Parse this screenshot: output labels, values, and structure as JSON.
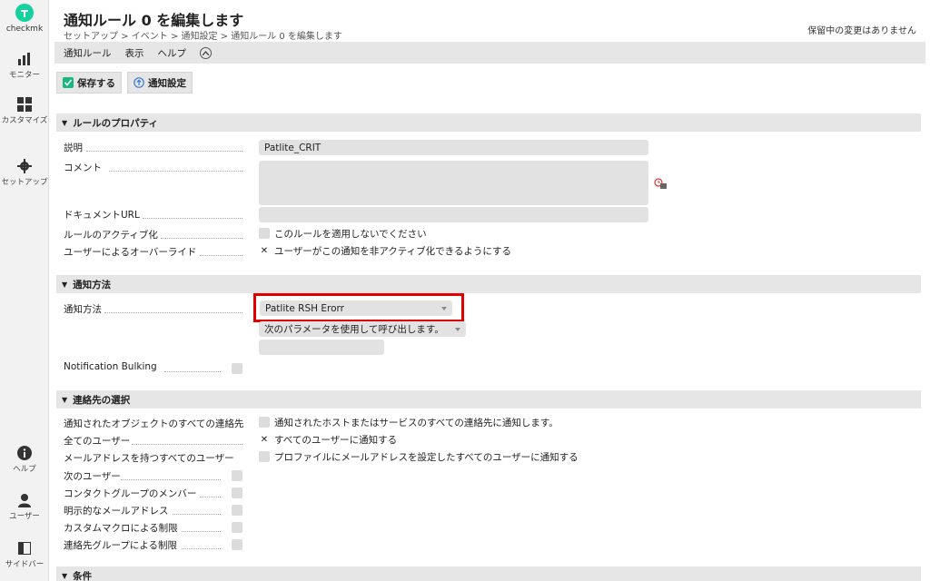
{
  "sidebar": {
    "logo_text": "checkmk",
    "items": [
      {
        "label": "モニター",
        "icon": "bar-chart-icon"
      },
      {
        "label": "カスタマイズ",
        "icon": "grid-icon"
      },
      {
        "label": "セットアップ",
        "icon": "gear-icon"
      },
      {
        "label": "ヘルプ",
        "icon": "info-icon"
      },
      {
        "label": "ユーザー",
        "icon": "user-icon"
      },
      {
        "label": "サイドバー",
        "icon": "sidebar-icon"
      }
    ]
  },
  "header": {
    "title": "通知ルール 0 を編集します",
    "breadcrumb": "セットアップ > イベント > 通知設定 > 通知ルール 0 を編集します",
    "pending": "保留中の変更はありません"
  },
  "menu": {
    "items": [
      "通知ルール",
      "表示",
      "ヘルプ"
    ]
  },
  "toolbar": {
    "save_label": "保存する",
    "settings_label": "通知設定"
  },
  "sections": {
    "properties": {
      "title": "ルールのプロパティ",
      "description_label": "説明",
      "description_value": "Patlite_CRIT",
      "comment_label": "コメント",
      "docurl_label": "ドキュメントURL",
      "deactivate_label": "ルールのアクティブ化",
      "deactivate_text": "このルールを適用しないでください",
      "override_label": "ユーザーによるオーバーライド",
      "override_text": "ユーザーがこの通知を非アクティブ化できるようにする",
      "override_checked": "✕"
    },
    "method": {
      "title": "通知方法",
      "method_label": "通知方法",
      "method_value": "Patlite RSH Erorr",
      "param_value": "次のパラメータを使用して呼び出します。",
      "bulking_label": "Notification Bulking"
    },
    "contacts": {
      "title": "連絡先の選択",
      "rows": [
        {
          "label": "通知されたオブジェクトのすべての連絡先",
          "text": "通知されたホストまたはサービスのすべての連絡先に通知します。",
          "checked": ""
        },
        {
          "label": "全てのユーザー",
          "text": "すべてのユーザーに通知する",
          "checked": "✕"
        },
        {
          "label": "メールアドレスを持つすべてのユーザー",
          "text": "プロファイルにメールアドレスを設定したすべてのユーザーに通知する",
          "checked": ""
        },
        {
          "label": "次のユーザー",
          "text": "",
          "checked": ""
        },
        {
          "label": "コンタクトグループのメンバー",
          "text": "",
          "checked": ""
        },
        {
          "label": "明示的なメールアドレス",
          "text": "",
          "checked": ""
        },
        {
          "label": "カスタムマクロによる制限",
          "text": "",
          "checked": ""
        },
        {
          "label": "連絡先グループによる制限",
          "text": "",
          "checked": ""
        }
      ]
    },
    "conditions": {
      "title": "条件"
    }
  }
}
